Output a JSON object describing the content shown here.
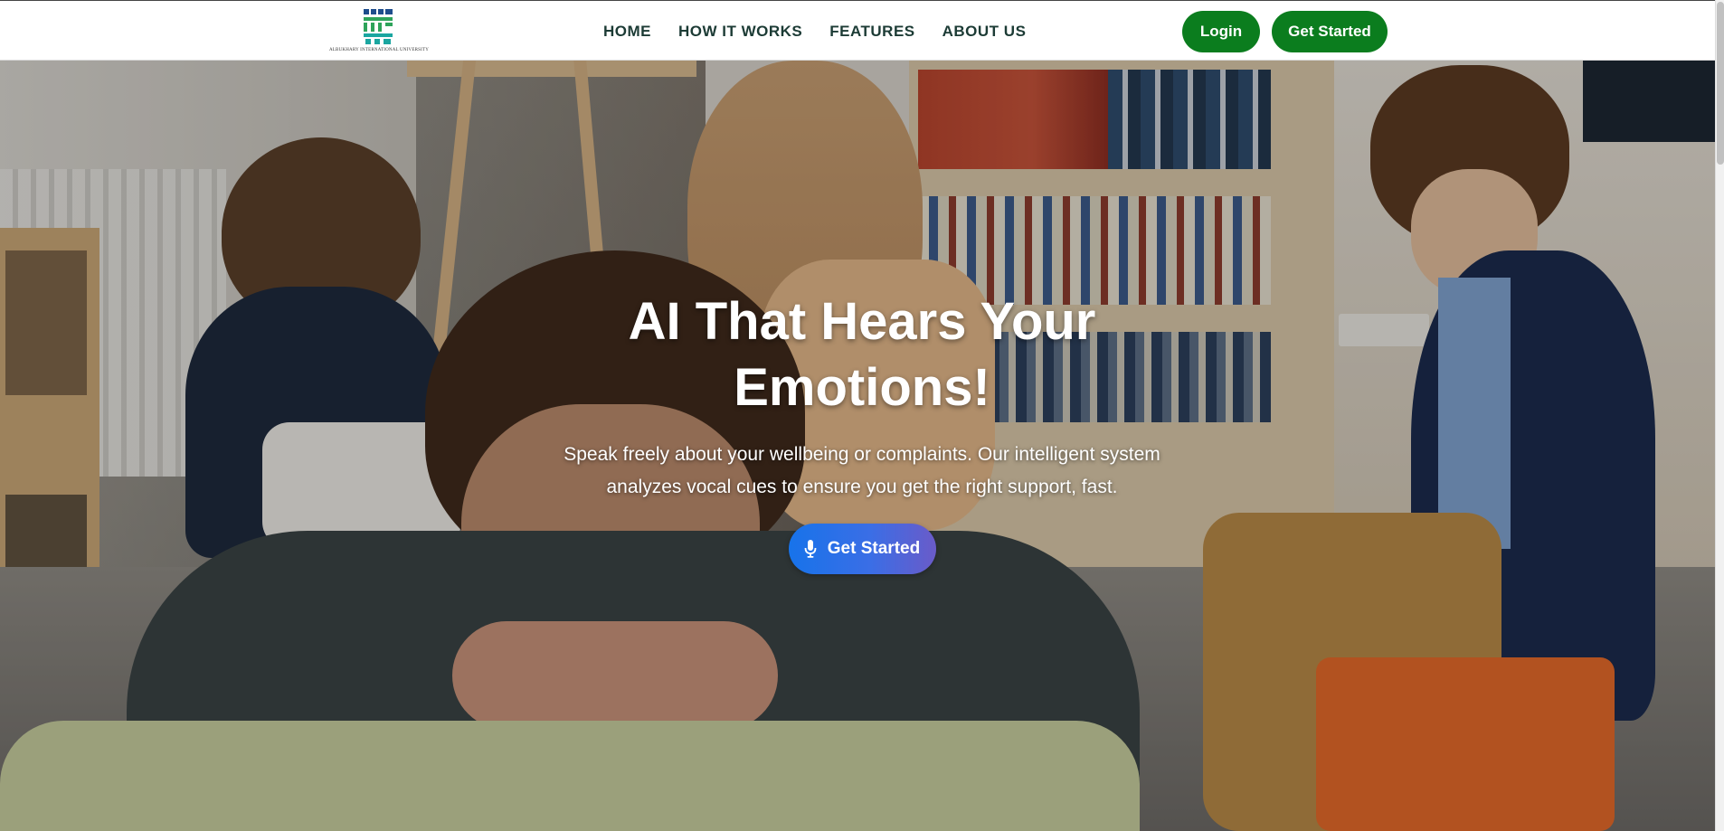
{
  "brand": {
    "logo_alt": "Albukhary International University logo",
    "logo_text": "ALBUKHARY INTERNATIONAL UNIVERSITY"
  },
  "nav": {
    "links": [
      "HOME",
      "HOW IT WORKS",
      "FEATURES",
      "ABOUT US"
    ],
    "login_label": "Login",
    "get_started_label": "Get Started"
  },
  "hero": {
    "title": "AI That Hears Your Emotions!",
    "subtitle": "Speak freely about your wellbeing or complaints. Our intelligent system analyzes vocal cues to ensure you get the right support, fast.",
    "cta_label": "Get Started",
    "cta_icon": "microphone-icon"
  },
  "colors": {
    "nav_text": "#1c3b35",
    "primary_green": "#0b7d1e",
    "cta_gradient_start": "#1773ea",
    "cta_gradient_end": "#6a5bc9"
  }
}
